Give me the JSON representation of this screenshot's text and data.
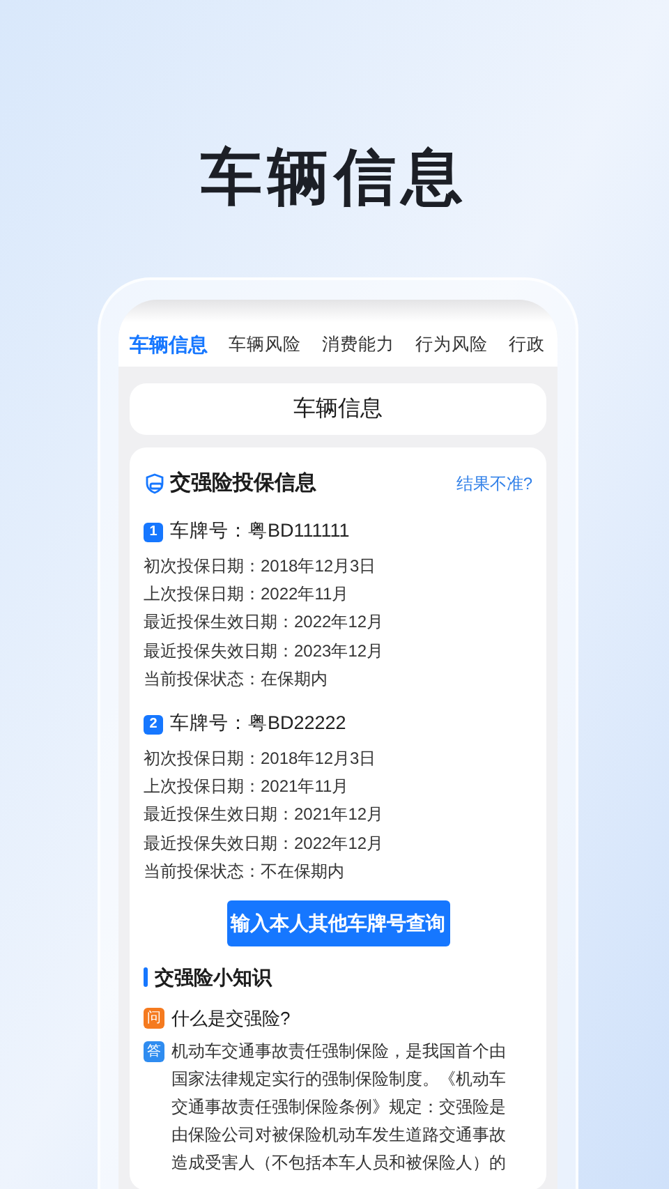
{
  "headline": "车辆信息",
  "tabs": [
    {
      "label": "车辆信息",
      "selected": true
    },
    {
      "label": "车辆风险",
      "selected": false
    },
    {
      "label": "消费能力",
      "selected": false
    },
    {
      "label": "行为风险",
      "selected": false
    },
    {
      "label": "行政",
      "selected": false
    }
  ],
  "page_title": "车辆信息",
  "insurance": {
    "title": "交强险投保信息",
    "link": "结果不准?",
    "vehicles": [
      {
        "index": "1",
        "plate": "车牌号：粤BD111111",
        "lines": [
          "初次投保日期：2018年12月3日",
          "上次投保日期：2022年11月",
          "最近投保生效日期：2022年12月",
          "最近投保失效日期：2023年12月",
          "当前投保状态：在保期内"
        ]
      },
      {
        "index": "2",
        "plate": "车牌号：粤BD22222",
        "lines": [
          "初次投保日期：2018年12月3日",
          "上次投保日期：2021年11月",
          "最近投保生效日期：2021年12月",
          "最近投保失效日期：2022年12月",
          "当前投保状态：不在保期内"
        ]
      }
    ],
    "button": "输入本人其他车牌号查询"
  },
  "knowledge": {
    "title": "交强险小知识",
    "question_mark": "问",
    "question": "什么是交强险?",
    "answer_mark": "答",
    "answer": "机动车交通事故责任强制保险，是我国首个由国家法律规定实行的强制保险制度。《机动车交通事故责任强制保险条例》规定：交强险是由保险公司对被保险机动车发生道路交通事故造成受害人（不包括本车人员和被保险人）的"
  }
}
